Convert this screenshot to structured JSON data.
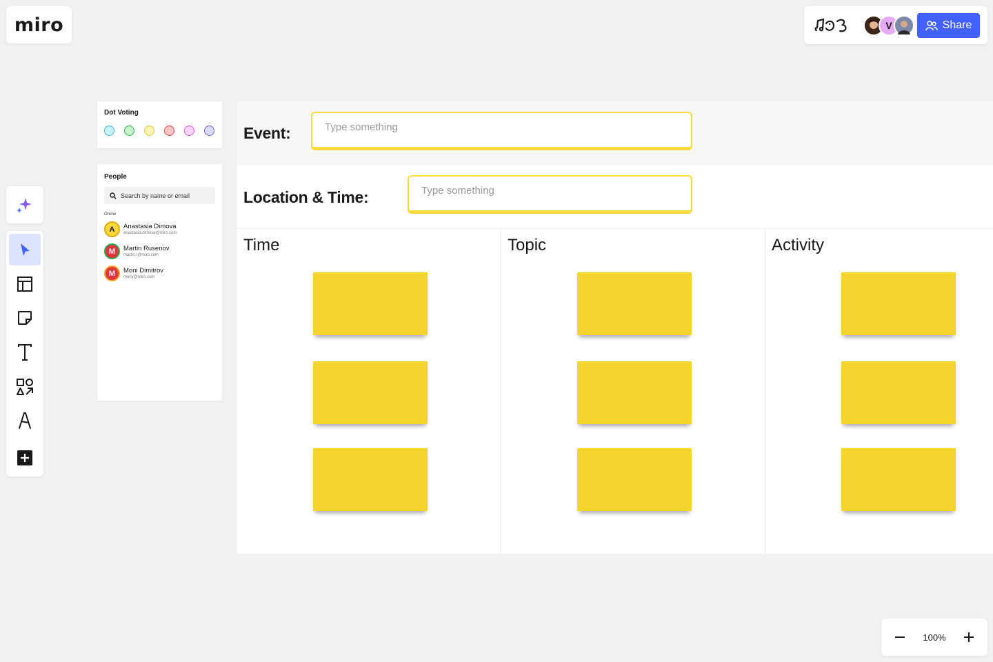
{
  "app": {
    "logo": "miro"
  },
  "header": {
    "share_label": "Share",
    "avatars": [
      {
        "initial": "",
        "color": "#8a5a3c"
      },
      {
        "initial": "V",
        "color": "#e6a9f5"
      },
      {
        "initial": "",
        "color": "#9aa3b5"
      }
    ]
  },
  "toolbar": {
    "items": [
      "ai-sparkle-icon",
      "select-cursor-icon",
      "templates-icon",
      "sticky-note-icon",
      "text-icon",
      "shapes-icon",
      "pen-icon",
      "more-plus-icon"
    ]
  },
  "dot_voting": {
    "title": "Dot Voting",
    "dots": [
      {
        "fill": "#c9f1fb",
        "stroke": "#39b7d7"
      },
      {
        "fill": "#c7f0cc",
        "stroke": "#2db34a"
      },
      {
        "fill": "#fdf3b0",
        "stroke": "#e2c83a"
      },
      {
        "fill": "#fbc5c5",
        "stroke": "#e0474c"
      },
      {
        "fill": "#f9d4f9",
        "stroke": "#d35bd6"
      },
      {
        "fill": "#dcd9fb",
        "stroke": "#6e63d9"
      }
    ]
  },
  "people": {
    "title": "People",
    "search_placeholder": "Search by name or email",
    "online_label": "Online",
    "list": [
      {
        "initial": "A",
        "name": "Anastasia Dimova",
        "email": "anastasia.dimova@miro.com",
        "bg": "#fcd93a",
        "ring": "#e0a800",
        "fg": "#1a1a1a"
      },
      {
        "initial": "M",
        "name": "Martin Rusenov",
        "email": "martin.r@miro.com",
        "bg": "#e0373c",
        "ring": "#2fa84f",
        "fg": "#ffffff"
      },
      {
        "initial": "M",
        "name": "Moni Dimitrov",
        "email": "mony@miro.com",
        "bg": "#e0373c",
        "ring": "#f5a623",
        "fg": "#ffffff"
      }
    ]
  },
  "board": {
    "event_label": "Event:",
    "event_placeholder": "Type something",
    "location_label": "Location & Time:",
    "location_placeholder": "Type something",
    "columns": [
      "Time",
      "Topic",
      "Activity"
    ]
  },
  "zoom": {
    "value": "100%"
  },
  "colors": {
    "accent": "#4262ff",
    "sticky": "#f6d42e",
    "input_border": "#fcd93a"
  }
}
